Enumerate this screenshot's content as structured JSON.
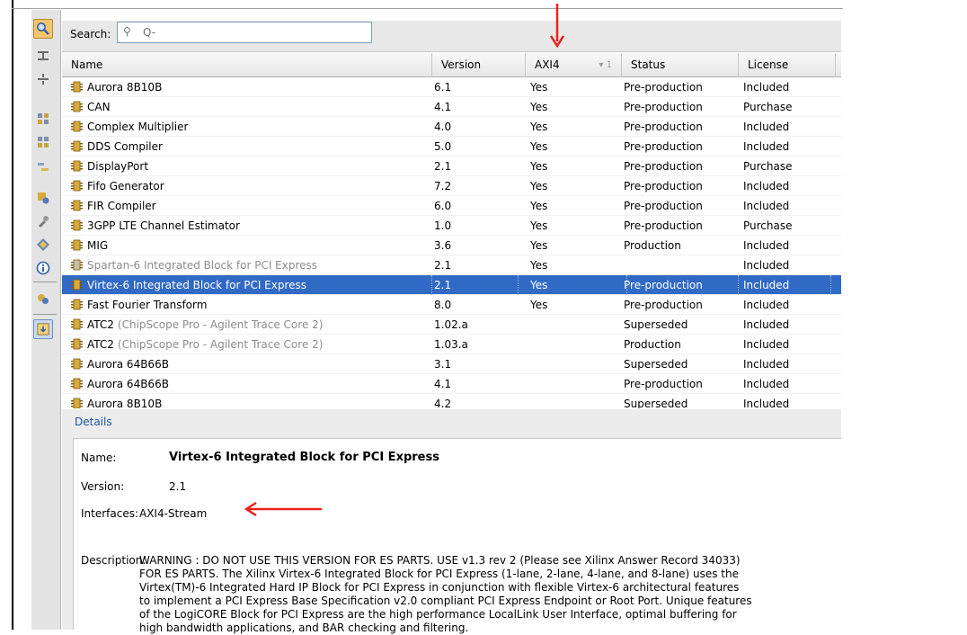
{
  "colors": {
    "selection_bg": "#316ac5",
    "details_title": "#1c56a8",
    "arrow": "#e8231c",
    "dim_text": "#8c8c8c"
  },
  "toolbar": {
    "icons": [
      "search-icon",
      "collapse-all-icon",
      "expand-all-icon",
      "group-by-function-icon",
      "group-by-vendor-icon",
      "filter-icon",
      "ip-settings-icon",
      "tools-icon",
      "ip-properties-icon",
      "info-icon",
      "upgrade-icon",
      "customize-icon"
    ]
  },
  "search": {
    "label": "Search:",
    "value": "",
    "placeholder": "Q-"
  },
  "table": {
    "columns": [
      {
        "label": "Name"
      },
      {
        "label": "Version"
      },
      {
        "label": "AXI4",
        "sort": "1"
      },
      {
        "label": "Status"
      },
      {
        "label": "License"
      }
    ],
    "rows": [
      {
        "name": "Aurora 8B10B",
        "extra": "",
        "version": "6.1",
        "axi4": "Yes",
        "status": "Pre-production",
        "license": "Included"
      },
      {
        "name": "CAN",
        "extra": "",
        "version": "4.1",
        "axi4": "Yes",
        "status": "Pre-production",
        "license": "Purchase"
      },
      {
        "name": "Complex Multiplier",
        "extra": "",
        "version": "4.0",
        "axi4": "Yes",
        "status": "Pre-production",
        "license": "Included"
      },
      {
        "name": "DDS Compiler",
        "extra": "",
        "version": "5.0",
        "axi4": "Yes",
        "status": "Pre-production",
        "license": "Included"
      },
      {
        "name": "DisplayPort",
        "extra": "",
        "version": "2.1",
        "axi4": "Yes",
        "status": "Pre-production",
        "license": "Purchase"
      },
      {
        "name": "Fifo Generator",
        "extra": "",
        "version": "7.2",
        "axi4": "Yes",
        "status": "Pre-production",
        "license": "Included"
      },
      {
        "name": "FIR Compiler",
        "extra": "",
        "version": "6.0",
        "axi4": "Yes",
        "status": "Pre-production",
        "license": "Included"
      },
      {
        "name": "3GPP LTE Channel Estimator",
        "extra": "",
        "version": "1.0",
        "axi4": "Yes",
        "status": "Pre-production",
        "license": "Purchase"
      },
      {
        "name": "MIG",
        "extra": "",
        "version": "3.6",
        "axi4": "Yes",
        "status": "Production",
        "license": "Included"
      },
      {
        "name": "Spartan-6 Integrated Block for PCI Express",
        "extra": "",
        "version": "2.1",
        "axi4": "Yes",
        "status": "",
        "license": "Included",
        "dim": true
      },
      {
        "name": "Virtex-6 Integrated Block for PCI Express",
        "extra": "",
        "version": "2.1",
        "axi4": "Yes",
        "status": "Pre-production",
        "license": "Included",
        "selected": true
      },
      {
        "name": "Fast Fourier Transform",
        "extra": "",
        "version": "8.0",
        "axi4": "Yes",
        "status": "Pre-production",
        "license": "Included"
      },
      {
        "name": "ATC2",
        "extra": "(ChipScope Pro - Agilent Trace Core 2)",
        "version": "1.02.a",
        "axi4": "",
        "status": "Superseded",
        "license": "Included"
      },
      {
        "name": "ATC2",
        "extra": "(ChipScope Pro - Agilent Trace Core 2)",
        "version": "1.03.a",
        "axi4": "",
        "status": "Production",
        "license": "Included"
      },
      {
        "name": "Aurora 64B66B",
        "extra": "",
        "version": "3.1",
        "axi4": "",
        "status": "Superseded",
        "license": "Included"
      },
      {
        "name": "Aurora 64B66B",
        "extra": "",
        "version": "4.1",
        "axi4": "",
        "status": "Pre-production",
        "license": "Included"
      },
      {
        "name": "Aurora 8B10B",
        "extra": "",
        "version": "4.2",
        "axi4": "",
        "status": "Superseded",
        "license": "Included"
      }
    ]
  },
  "details": {
    "title": "Details",
    "name_label": "Name:",
    "name_value": "Virtex-6 Integrated Block for PCI Express",
    "version_label": "Version:",
    "version_value": "2.1",
    "interfaces_label": "Interfaces:",
    "interfaces_value": "AXI4-Stream",
    "description_label": "Description:",
    "description_lines": [
      "WARNING : DO NOT USE THIS VERSION FOR ES PARTS. USE v1.3 rev 2 (Please see Xilinx Answer Record 34033)",
      "FOR ES PARTS. The Xilinx Virtex-6 Integrated Block for PCI Express (1-lane, 2-lane, 4-lane, and 8-lane) uses the",
      "Virtex(TM)-6 Integrated Hard IP Block for PCI Express in conjunction with flexible Virtex-6 architectural features",
      "to implement a PCI Express Base Specification v2.0 compliant PCI Express Endpoint or Root Port. Unique features",
      "of the LogiCORE Block for PCI Express are the high performance LocalLink User Interface, optimal buffering for",
      "high bandwidth applications, and BAR checking and filtering."
    ]
  }
}
